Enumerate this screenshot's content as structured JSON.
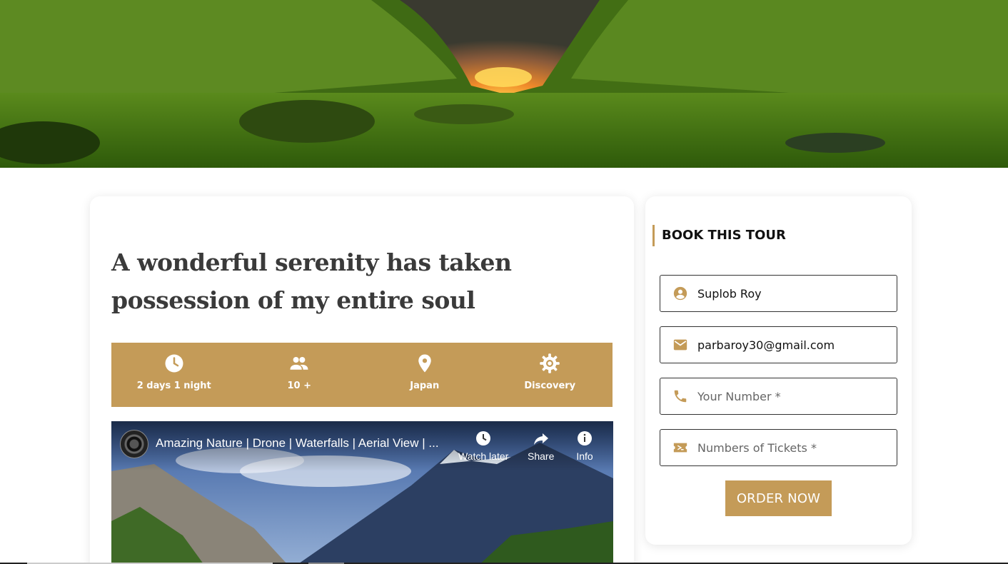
{
  "hero": {
    "image": "mountain-valley-sunset"
  },
  "tour": {
    "title": "A wonderful serenity has taken possession of my entire soul",
    "features": [
      {
        "icon": "clock-icon",
        "label": "2 days 1 night"
      },
      {
        "icon": "people-icon",
        "label": "10 +"
      },
      {
        "icon": "location-pin-icon",
        "label": "Japan"
      },
      {
        "icon": "gear-icon",
        "label": "Discovery"
      }
    ],
    "video": {
      "title": "Amazing Nature | Drone | Waterfalls | Aerial View | ...",
      "watch_later": "Watch later",
      "share": "Share",
      "info": "Info"
    }
  },
  "booking": {
    "heading": "BOOK THIS TOUR",
    "name_value": "Suplob Roy",
    "email_value": "parbaroy30@gmail.com",
    "phone_placeholder": "Your Number *",
    "tickets_placeholder": "Numbers of Tickets *",
    "order_label": "ORDER NOW"
  },
  "colors": {
    "accent": "#c49b58"
  }
}
